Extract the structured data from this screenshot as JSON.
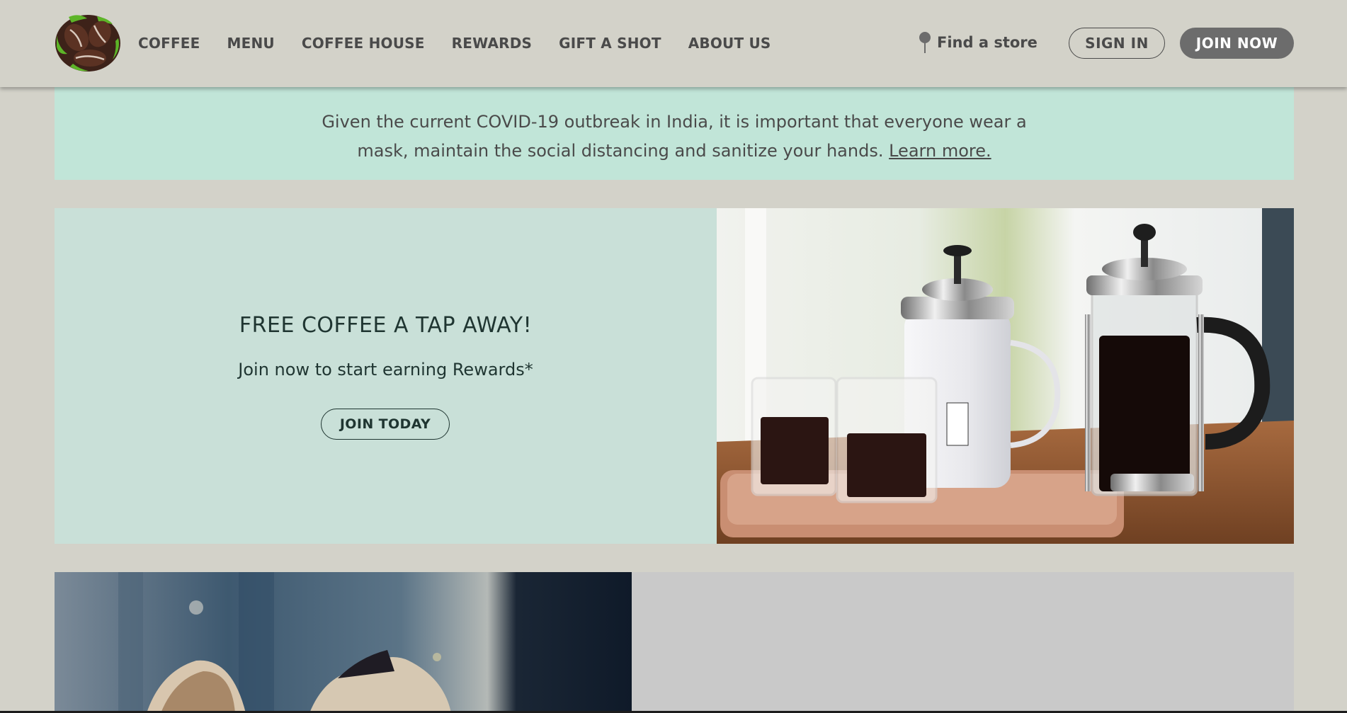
{
  "header": {
    "logo_name": "coffee-bean-logo",
    "nav": [
      "COFFEE",
      "MENU",
      "COFFEE HOUSE",
      "REWARDS",
      "GIFT A SHOT",
      "ABOUT US"
    ],
    "find_store": "Find a store",
    "sign_in": "SIGN IN",
    "join_now": "JOIN NOW"
  },
  "notice": {
    "line1": "Given the current COVID-19 outbreak in India, it is important that everyone wear a",
    "line2": "mask, maintain the social distancing and sanitize your hands.",
    "learn_more": "Learn more."
  },
  "promo": {
    "title": "FREE COFFEE A TAP AWAY!",
    "subtitle": "Join now to start earning Rewards*",
    "button": "JOIN TODAY",
    "image_icon": "french-press-coffee-image"
  },
  "colors": {
    "page_bg": "#d3d2c9",
    "notice_bg": "#c1e5d8",
    "promo_bg": "#c9e0d8",
    "join_button": "#6c6c6c",
    "grey_panel": "#c9c9c9"
  }
}
